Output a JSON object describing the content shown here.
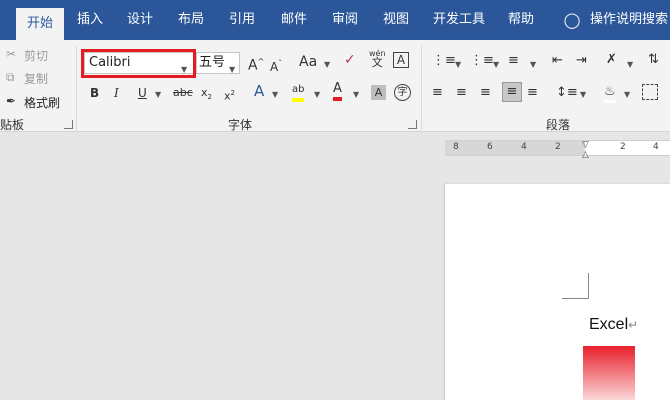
{
  "tabs": [
    "开始",
    "插入",
    "设计",
    "布局",
    "引用",
    "邮件",
    "审阅",
    "视图",
    "开发工具",
    "帮助"
  ],
  "tell_me": "操作说明搜索",
  "clipboard": {
    "cut": "剪切",
    "copy": "复制",
    "format_painter": "格式刷",
    "group_label": "贴板"
  },
  "font": {
    "name": "Calibri",
    "size": "五号",
    "group_label": "字体",
    "wen_top": "wén",
    "wen_bottom": "文"
  },
  "paragraph": {
    "group_label": "段落"
  },
  "ruler": {
    "numbers": [
      "8",
      "6",
      "4",
      "2",
      "2",
      "4"
    ]
  },
  "document": {
    "text": "Excel",
    "pilcrow": "↵"
  },
  "colors": {
    "accent": "#2b579a",
    "highlight_frame": "#e31b23",
    "font_color": "#e31b23",
    "highlight": "#ffff00"
  }
}
